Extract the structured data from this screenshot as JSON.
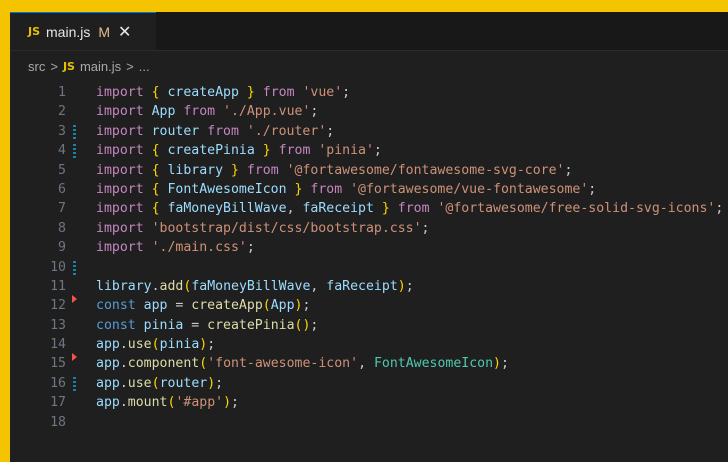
{
  "tab": {
    "badge": "JS",
    "filename": "main.js",
    "modified": "M",
    "close_icon": "close-icon"
  },
  "breadcrumb": {
    "folder": "src",
    "sep": ">",
    "badge": "JS",
    "file": "main.js",
    "more": "..."
  },
  "gutter": {
    "1": "",
    "2": "",
    "3": "modified",
    "4": "modified",
    "5": "",
    "6": "",
    "7": "",
    "8": "",
    "9": "",
    "10": "modified",
    "11": "",
    "12": "deleted",
    "13": "",
    "14": "",
    "15": "deleted",
    "16": "modified",
    "17": "",
    "18": ""
  },
  "code": [
    {
      "n": "1",
      "t": [
        [
          "kw",
          "import "
        ],
        [
          "br1",
          "{ "
        ],
        [
          "var",
          "createApp"
        ],
        [
          "br1",
          " }"
        ],
        [
          "kw",
          " from "
        ],
        [
          "str",
          "'vue'"
        ],
        [
          "plain",
          ";"
        ]
      ]
    },
    {
      "n": "2",
      "t": [
        [
          "kw",
          "import "
        ],
        [
          "var",
          "App"
        ],
        [
          "kw",
          " from "
        ],
        [
          "str",
          "'./App.vue'"
        ],
        [
          "plain",
          ";"
        ]
      ]
    },
    {
      "n": "3",
      "t": [
        [
          "kw",
          "import "
        ],
        [
          "var",
          "router"
        ],
        [
          "kw",
          " from "
        ],
        [
          "str",
          "'./router'"
        ],
        [
          "plain",
          ";"
        ]
      ]
    },
    {
      "n": "4",
      "t": [
        [
          "kw",
          "import "
        ],
        [
          "br1",
          "{ "
        ],
        [
          "var",
          "createPinia"
        ],
        [
          "br1",
          " }"
        ],
        [
          "kw",
          " from "
        ],
        [
          "str",
          "'pinia'"
        ],
        [
          "plain",
          ";"
        ]
      ]
    },
    {
      "n": "5",
      "t": [
        [
          "kw",
          "import "
        ],
        [
          "br1",
          "{ "
        ],
        [
          "var",
          "library"
        ],
        [
          "br1",
          " }"
        ],
        [
          "kw",
          " from "
        ],
        [
          "str",
          "'@fortawesome/fontawesome-svg-core'"
        ],
        [
          "plain",
          ";"
        ]
      ]
    },
    {
      "n": "6",
      "t": [
        [
          "kw",
          "import "
        ],
        [
          "br1",
          "{ "
        ],
        [
          "var",
          "FontAwesomeIcon"
        ],
        [
          "br1",
          " }"
        ],
        [
          "kw",
          " from "
        ],
        [
          "str",
          "'@fortawesome/vue-fontawesome'"
        ],
        [
          "plain",
          ";"
        ]
      ]
    },
    {
      "n": "7",
      "t": [
        [
          "kw",
          "import "
        ],
        [
          "br1",
          "{ "
        ],
        [
          "var",
          "faMoneyBillWave"
        ],
        [
          "plain",
          ", "
        ],
        [
          "var",
          "faReceipt"
        ],
        [
          "br1",
          " }"
        ],
        [
          "kw",
          " from "
        ],
        [
          "str",
          "'@fortawesome/free-solid-svg-icons'"
        ],
        [
          "plain",
          ";"
        ]
      ]
    },
    {
      "n": "8",
      "t": [
        [
          "kw",
          "import "
        ],
        [
          "str",
          "'bootstrap/dist/css/bootstrap.css'"
        ],
        [
          "plain",
          ";"
        ]
      ]
    },
    {
      "n": "9",
      "t": [
        [
          "kw",
          "import "
        ],
        [
          "str",
          "'./main.css'"
        ],
        [
          "plain",
          ";"
        ]
      ]
    },
    {
      "n": "10",
      "t": []
    },
    {
      "n": "11",
      "t": [
        [
          "var",
          "library"
        ],
        [
          "plain",
          "."
        ],
        [
          "fn",
          "add"
        ],
        [
          "br1",
          "("
        ],
        [
          "var",
          "faMoneyBillWave"
        ],
        [
          "plain",
          ", "
        ],
        [
          "var",
          "faReceipt"
        ],
        [
          "br1",
          ")"
        ],
        [
          "plain",
          ";"
        ]
      ]
    },
    {
      "n": "12",
      "t": [
        [
          "kw2",
          "const "
        ],
        [
          "var",
          "app"
        ],
        [
          "plain",
          " = "
        ],
        [
          "fn",
          "createApp"
        ],
        [
          "br1",
          "("
        ],
        [
          "var",
          "App"
        ],
        [
          "br1",
          ")"
        ],
        [
          "plain",
          ";"
        ]
      ]
    },
    {
      "n": "13",
      "t": [
        [
          "kw2",
          "const "
        ],
        [
          "var",
          "pinia"
        ],
        [
          "plain",
          " = "
        ],
        [
          "fn",
          "createPinia"
        ],
        [
          "br1",
          "()"
        ],
        [
          "plain",
          ";"
        ]
      ]
    },
    {
      "n": "14",
      "t": [
        [
          "var",
          "app"
        ],
        [
          "plain",
          "."
        ],
        [
          "fn",
          "use"
        ],
        [
          "br1",
          "("
        ],
        [
          "var",
          "pinia"
        ],
        [
          "br1",
          ")"
        ],
        [
          "plain",
          ";"
        ]
      ]
    },
    {
      "n": "15",
      "t": [
        [
          "var",
          "app"
        ],
        [
          "plain",
          "."
        ],
        [
          "fn",
          "component"
        ],
        [
          "br1",
          "("
        ],
        [
          "str",
          "'font-awesome-icon'"
        ],
        [
          "plain",
          ", "
        ],
        [
          "cls",
          "FontAwesomeIcon"
        ],
        [
          "br1",
          ")"
        ],
        [
          "plain",
          ";"
        ]
      ]
    },
    {
      "n": "16",
      "t": [
        [
          "var",
          "app"
        ],
        [
          "plain",
          "."
        ],
        [
          "fn",
          "use"
        ],
        [
          "br1",
          "("
        ],
        [
          "var",
          "router"
        ],
        [
          "br1",
          ")"
        ],
        [
          "plain",
          ";"
        ]
      ]
    },
    {
      "n": "17",
      "t": [
        [
          "var",
          "app"
        ],
        [
          "plain",
          "."
        ],
        [
          "fn",
          "mount"
        ],
        [
          "br1",
          "("
        ],
        [
          "str",
          "'#app'"
        ],
        [
          "br1",
          ")"
        ],
        [
          "plain",
          ";"
        ]
      ]
    },
    {
      "n": "18",
      "t": []
    }
  ]
}
